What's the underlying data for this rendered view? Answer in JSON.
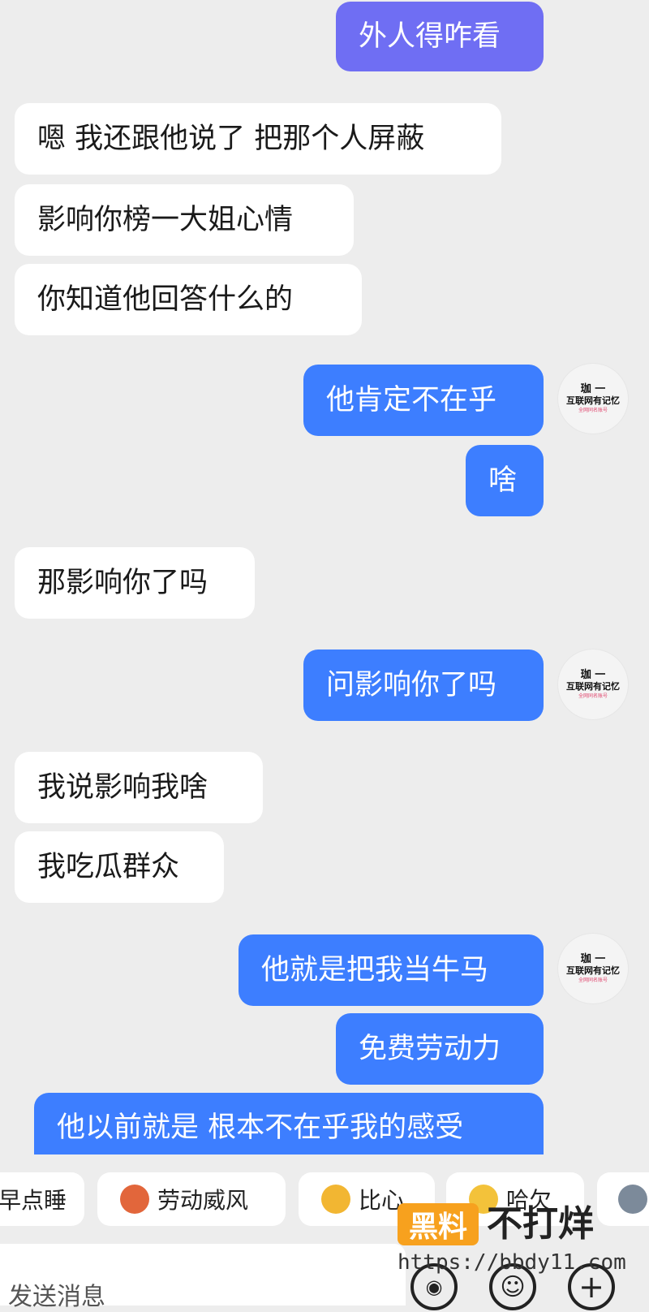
{
  "messages": [
    {
      "side": "out",
      "text": "外人得咋看",
      "violet": true
    },
    {
      "side": "in",
      "text": "嗯 我还跟他说了 把那个人屏蔽"
    },
    {
      "side": "in",
      "text": "影响你榜一大姐心情"
    },
    {
      "side": "in",
      "text": "你知道他回答什么的"
    },
    {
      "side": "out",
      "text": "他肯定不在乎"
    },
    {
      "side": "out",
      "text": "啥"
    },
    {
      "side": "in",
      "text": "那影响你了吗"
    },
    {
      "side": "out",
      "text": "问影响你了吗"
    },
    {
      "side": "in",
      "text": "我说影响我啥"
    },
    {
      "side": "in",
      "text": "我吃瓜群众"
    },
    {
      "side": "out",
      "text": "他就是把我当牛马"
    },
    {
      "side": "out",
      "text": "免费劳动力"
    },
    {
      "side": "out",
      "text": "他以前就是 根本不在乎我的感受"
    }
  ],
  "avatar": {
    "name": "珈 一",
    "subtitle": "互联网有记忆",
    "tiny_text": "全网同名账号"
  },
  "quick_replies": [
    {
      "label": "早点睡",
      "icon": "none"
    },
    {
      "label": "劳动威风",
      "icon": "crab-emoji-icon"
    },
    {
      "label": "比心",
      "icon": "heart-emoji-icon"
    },
    {
      "label": "哈欠",
      "icon": "yawn-emoji-icon"
    },
    {
      "label": "",
      "icon": "wolf-emoji-icon"
    }
  ],
  "input": {
    "placeholder": "发送消息"
  },
  "watermark": {
    "badge": "黑料",
    "title": "不打烊",
    "url": "https://bbdy11.com"
  },
  "colors": {
    "background": "#ededed",
    "incoming_bubble": "#ffffff",
    "outgoing_bubble": "#3d7eff",
    "outgoing_bubble_violet": "#6f6ef3",
    "watermark_badge": "#f7a11e"
  }
}
